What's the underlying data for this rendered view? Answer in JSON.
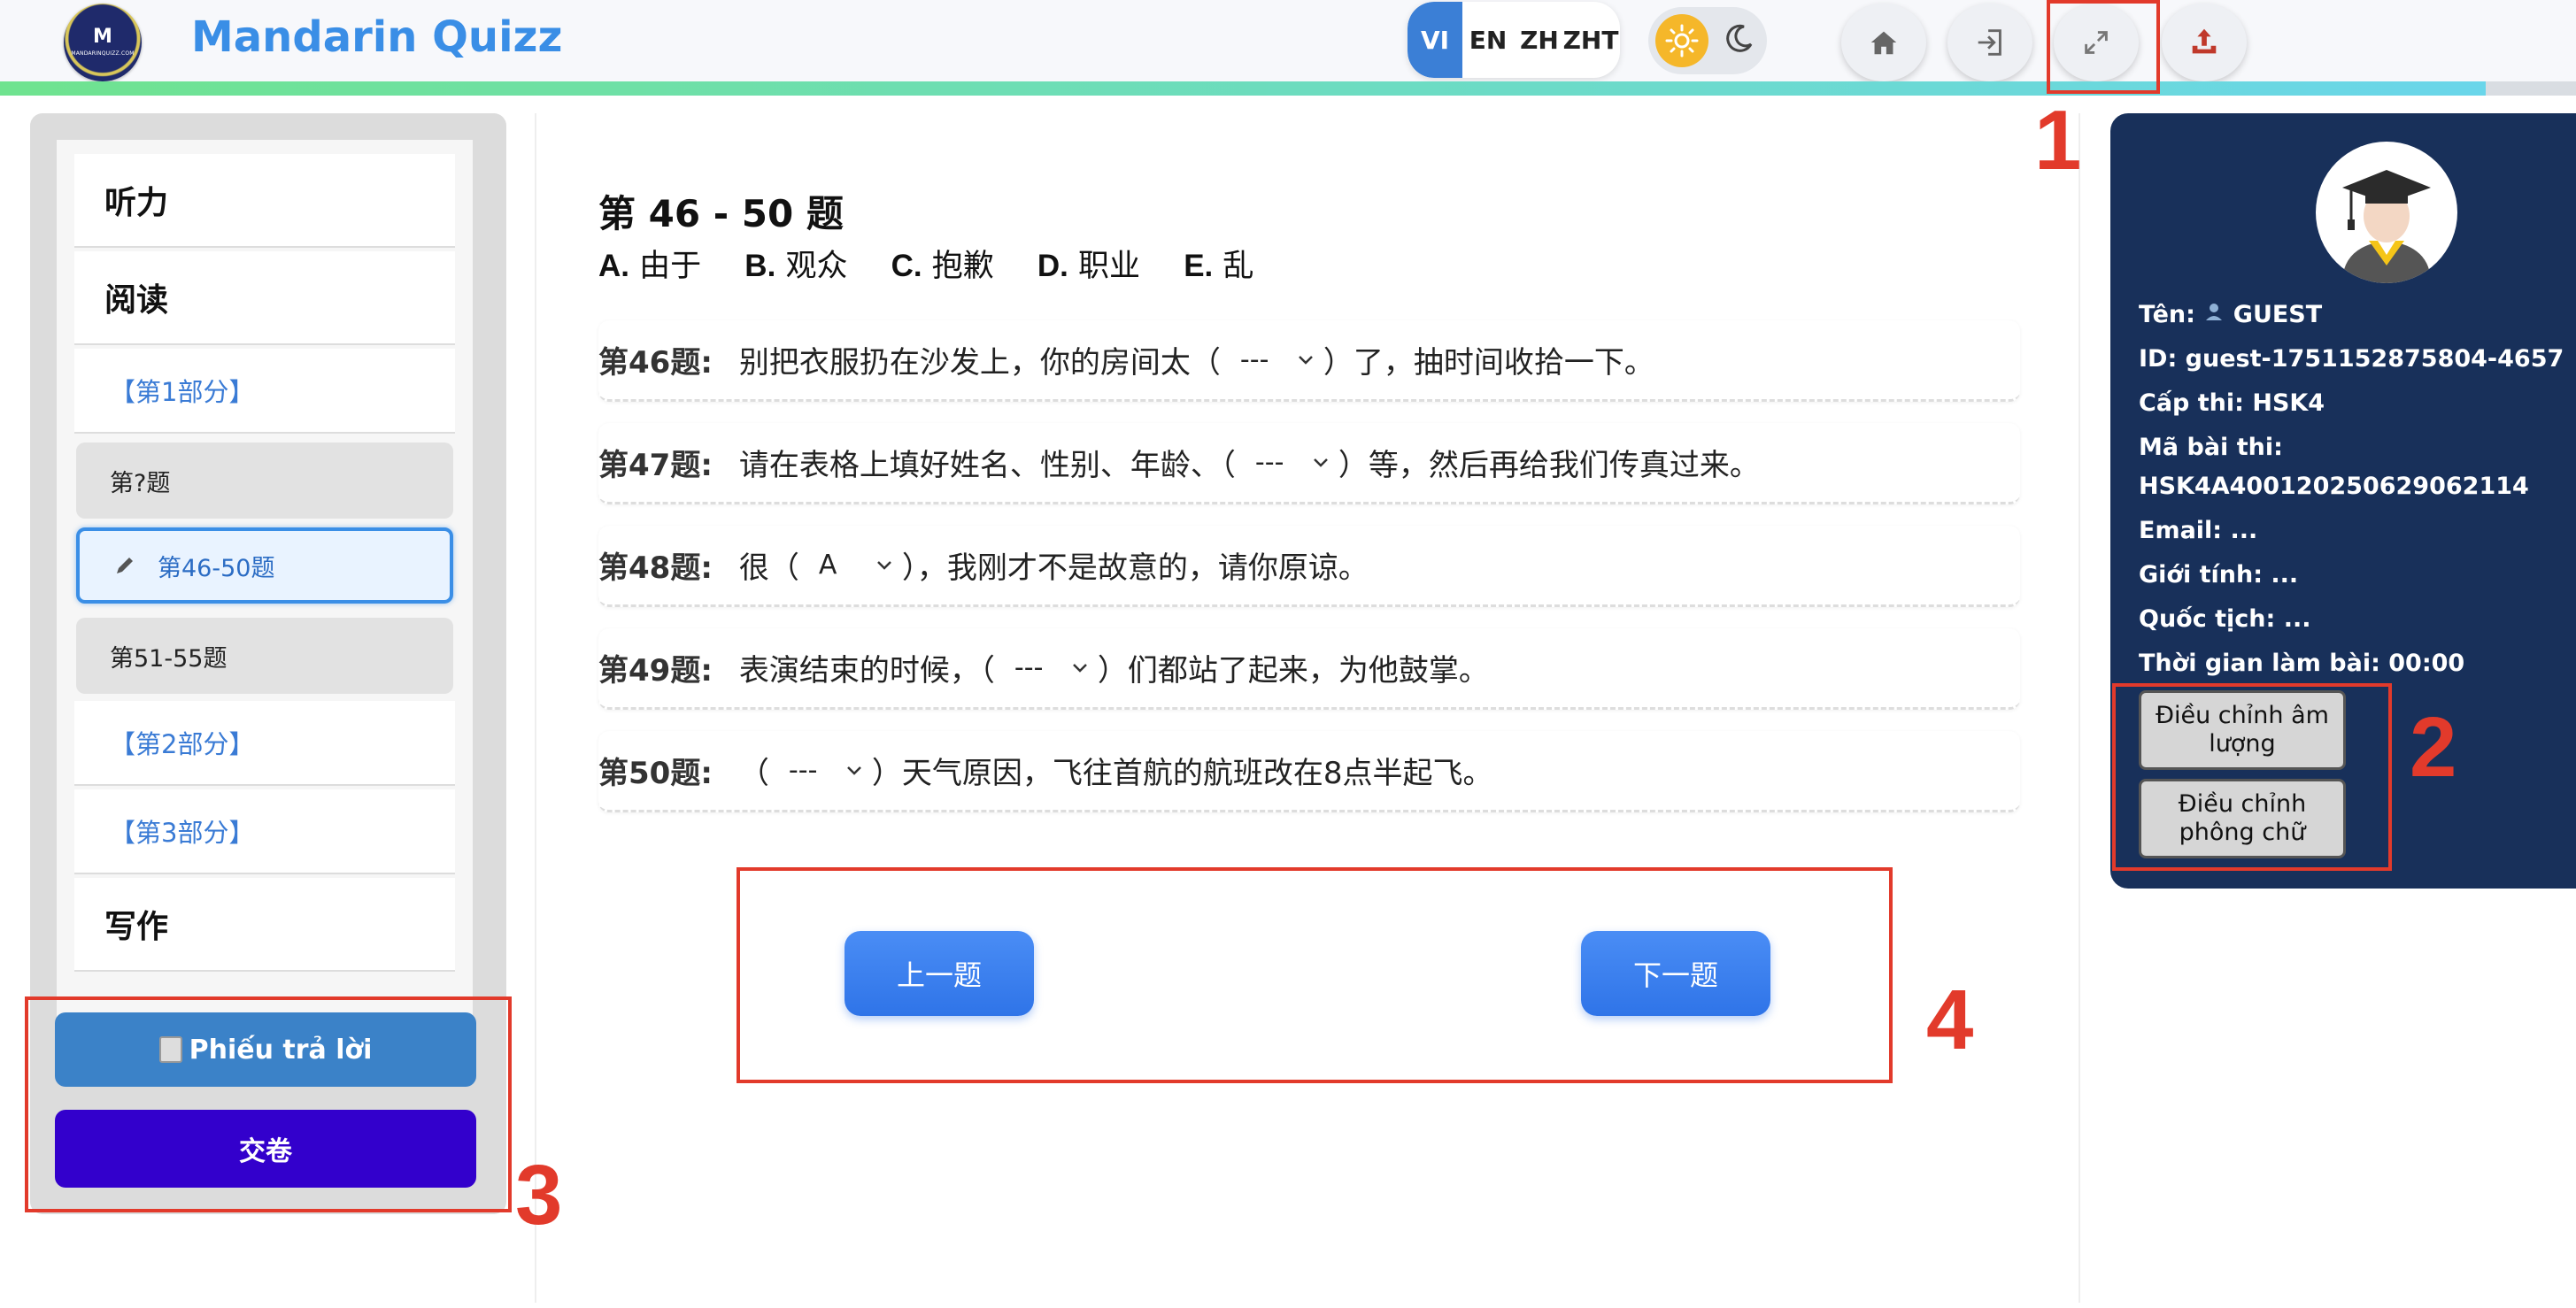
{
  "header": {
    "logo_letter": "M",
    "logo_small": "MANDARINQUIZZ.COM",
    "app_title": "Mandarin Quizz",
    "languages": [
      "VI",
      "EN",
      "ZH",
      "ZHT"
    ],
    "active_language": "VI",
    "theme": "light",
    "buttons": [
      "home-icon",
      "login-icon",
      "fullscreen-icon",
      "upload-icon"
    ],
    "progress_fraction": 0.965
  },
  "sidebar": {
    "listening": "听力",
    "reading": "阅读",
    "part1": "【第1部分】",
    "q_unknown": "第?题",
    "q_46_50": "第46-50题",
    "q_51_55": "第51-55题",
    "part2": "【第2部分】",
    "part3": "【第3部分】",
    "writing": "写作",
    "answer_sheet": "Phiếu trả lời",
    "submit": "交卷"
  },
  "main": {
    "section_title": "第 46 - 50 题",
    "options": [
      {
        "letter": "A.",
        "word": "由于"
      },
      {
        "letter": "B.",
        "word": "观众"
      },
      {
        "letter": "C.",
        "word": "抱歉"
      },
      {
        "letter": "D.",
        "word": "职业"
      },
      {
        "letter": "E.",
        "word": "乱"
      }
    ],
    "questions": [
      {
        "num": "第46题:",
        "before": "别把衣服扔在沙发上，你的房间太（",
        "value": "---",
        "after": "）了，抽时间收拾一下。"
      },
      {
        "num": "第47题:",
        "before": "请在表格上填好姓名、性别、年龄、（",
        "value": "---",
        "after": "）等，然后再给我们传真过来。"
      },
      {
        "num": "第48题:",
        "before": "很（",
        "value": "A",
        "after": "），我刚才不是故意的，请你原谅。"
      },
      {
        "num": "第49题:",
        "before": "表演结束的时候，（",
        "value": "---",
        "after": "）们都站了起来，为他鼓掌。"
      },
      {
        "num": "第50题:",
        "before": "（",
        "value": "---",
        "after": "）天气原因，飞往首航的航班改在8点半起飞。"
      }
    ],
    "prev": "上一题",
    "next": "下一题"
  },
  "user": {
    "name_label": "Tên:",
    "name_value": "GUEST",
    "id": "ID: guest-1751152875804-4657",
    "level": "Cấp thi: HSK4",
    "exam_code_label": "Mã bài thi:",
    "exam_code": "HSK4A400120250629062114",
    "email": "Email: ...",
    "gender": "Giới tính: ...",
    "nationality": "Quốc tịch: ...",
    "time": "Thời gian làm bài: 00:00",
    "volume_btn": "Điều chỉnh âm lượng",
    "font_btn": "Điều chỉnh phông chữ"
  },
  "annotations": [
    "1",
    "2",
    "3",
    "4"
  ],
  "colors": {
    "brand": "#3a8ee6",
    "annotation": "#e23a2b",
    "submit": "#3300cc",
    "user_card": "#18305a"
  }
}
